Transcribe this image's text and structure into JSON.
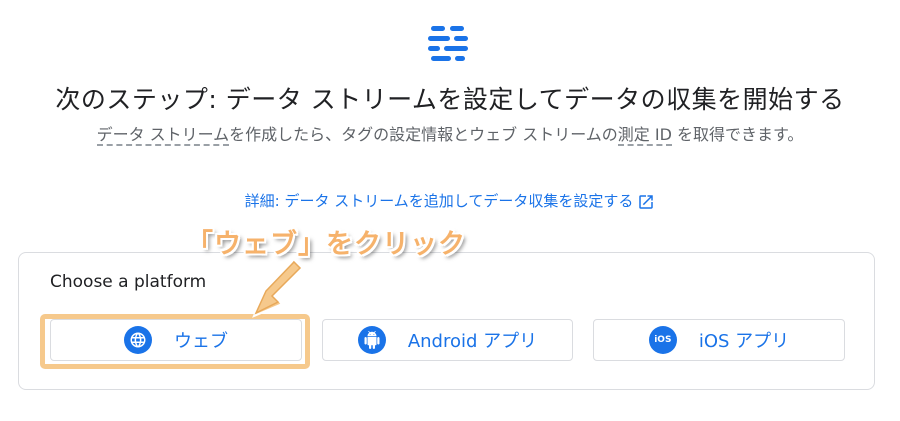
{
  "header": {
    "logo_icon": "data-streams-icon",
    "title": "次のステップ: データ ストリームを設定してデータの収集を開始する",
    "subtitle_parts": [
      "データ ストリーム",
      "を作成したら、タグの設定情報とウェブ ストリームの",
      "測定 ID",
      " を取得できます。"
    ],
    "detail_link": "詳細: データ ストリームを追加してデータ収集を設定する",
    "external_icon": "open-in-new-icon"
  },
  "annotation": {
    "callout": "「ウェブ」をクリック",
    "highlight_color": "#f6c98c",
    "arrow_icon": "arrow-down-left-icon"
  },
  "platform_card": {
    "title": "Choose a platform",
    "buttons": [
      {
        "label": "ウェブ",
        "icon": "globe-icon"
      },
      {
        "label_main": "Android",
        "label_suffix": " アプリ",
        "icon": "android-icon"
      },
      {
        "label_main": "iOS",
        "label_suffix": " アプリ",
        "icon": "ios-icon",
        "icon_text": "iOS"
      }
    ]
  },
  "colors": {
    "accent": "#1a73e8",
    "callout": "#f6b26b",
    "border": "#dadce0"
  }
}
